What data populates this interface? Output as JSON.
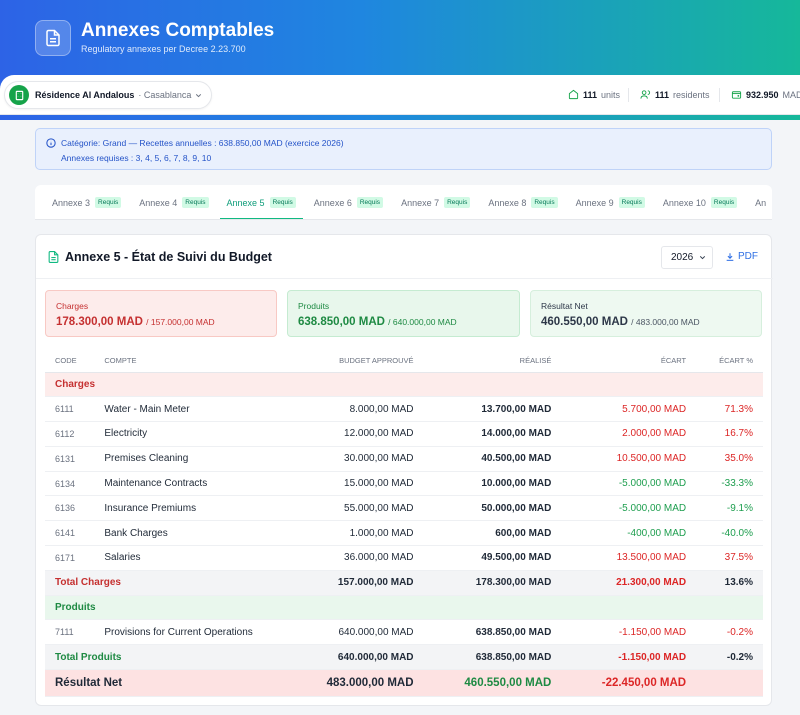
{
  "header": {
    "title": "Annexes Comptables",
    "subtitle": "Regulatory annexes per Decree 2.23.700"
  },
  "context": {
    "building_name": "Résidence Al Andalous",
    "building_city": "· Casablanca",
    "units_value": "111",
    "units_label": "units",
    "residents_value": "111",
    "residents_label": "residents",
    "balance_value": "932.950",
    "balance_unit": "MAD"
  },
  "info": {
    "line1": "Catégorie: Grand — Recettes annuelles : 638.850,00 MAD (exercice 2026)",
    "line2": "Annexes requises : 3, 4, 5, 6, 7, 8, 9, 10"
  },
  "tabs": [
    {
      "label": "Annexe 3",
      "badge": "Requis"
    },
    {
      "label": "Annexe 4",
      "badge": "Requis"
    },
    {
      "label": "Annexe 5",
      "badge": "Requis"
    },
    {
      "label": "Annexe 6",
      "badge": "Requis"
    },
    {
      "label": "Annexe 7",
      "badge": "Requis"
    },
    {
      "label": "Annexe 8",
      "badge": "Requis"
    },
    {
      "label": "Annexe 9",
      "badge": "Requis"
    },
    {
      "label": "Annexe 10",
      "badge": "Requis"
    },
    {
      "label": "An"
    }
  ],
  "active_tab": 2,
  "card": {
    "title": "Annexe 5 - État de Suivi du Budget",
    "year": "2026",
    "pdf_label": "PDF"
  },
  "summary": {
    "charges": {
      "label": "Charges",
      "value": "178.300,00 MAD",
      "budget": "/ 157.000,00 MAD"
    },
    "produits": {
      "label": "Produits",
      "value": "638.850,00 MAD",
      "budget": "/ 640.000,00 MAD"
    },
    "resultat": {
      "label": "Résultat Net",
      "value": "460.550,00 MAD",
      "budget": "/ 483.000,00 MAD"
    }
  },
  "table": {
    "columns": [
      "CODE",
      "COMPTE",
      "BUDGET APPROUVÉ",
      "RÉALISÉ",
      "ÉCART",
      "ÉCART %"
    ],
    "charges_label": "Charges",
    "charges": [
      {
        "code": "6111",
        "compte": "Water - Main Meter",
        "budget": "8.000,00 MAD",
        "realise": "13.700,00 MAD",
        "ecart": "5.700,00 MAD",
        "pct": "71.3%",
        "sign": "pos"
      },
      {
        "code": "6112",
        "compte": "Electricity",
        "budget": "12.000,00 MAD",
        "realise": "14.000,00 MAD",
        "ecart": "2.000,00 MAD",
        "pct": "16.7%",
        "sign": "pos"
      },
      {
        "code": "6131",
        "compte": "Premises Cleaning",
        "budget": "30.000,00 MAD",
        "realise": "40.500,00 MAD",
        "ecart": "10.500,00 MAD",
        "pct": "35.0%",
        "sign": "pos"
      },
      {
        "code": "6134",
        "compte": "Maintenance Contracts",
        "budget": "15.000,00 MAD",
        "realise": "10.000,00 MAD",
        "ecart": "-5.000,00 MAD",
        "pct": "-33.3%",
        "sign": "neg"
      },
      {
        "code": "6136",
        "compte": "Insurance Premiums",
        "budget": "55.000,00 MAD",
        "realise": "50.000,00 MAD",
        "ecart": "-5.000,00 MAD",
        "pct": "-9.1%",
        "sign": "neg"
      },
      {
        "code": "6141",
        "compte": "Bank Charges",
        "budget": "1.000,00 MAD",
        "realise": "600,00 MAD",
        "ecart": "-400,00 MAD",
        "pct": "-40.0%",
        "sign": "neg"
      },
      {
        "code": "6171",
        "compte": "Salaries",
        "budget": "36.000,00 MAD",
        "realise": "49.500,00 MAD",
        "ecart": "13.500,00 MAD",
        "pct": "37.5%",
        "sign": "pos"
      }
    ],
    "total_charges": {
      "label": "Total Charges",
      "budget": "157.000,00 MAD",
      "realise": "178.300,00 MAD",
      "ecart": "21.300,00 MAD",
      "pct": "13.6%"
    },
    "produits_label": "Produits",
    "produits": [
      {
        "code": "7111",
        "compte": "Provisions for Current Operations",
        "budget": "640.000,00 MAD",
        "realise": "638.850,00 MAD",
        "ecart": "-1.150,00 MAD",
        "pct": "-0.2%",
        "sign": "pos"
      }
    ],
    "total_produits": {
      "label": "Total Produits",
      "budget": "640.000,00 MAD",
      "realise": "638.850,00 MAD",
      "ecart": "-1.150,00 MAD",
      "pct": "-0.2%"
    },
    "net": {
      "label": "Résultat Net",
      "budget": "483.000,00 MAD",
      "realise": "460.550,00 MAD",
      "ecart": "-22.450,00 MAD"
    }
  }
}
